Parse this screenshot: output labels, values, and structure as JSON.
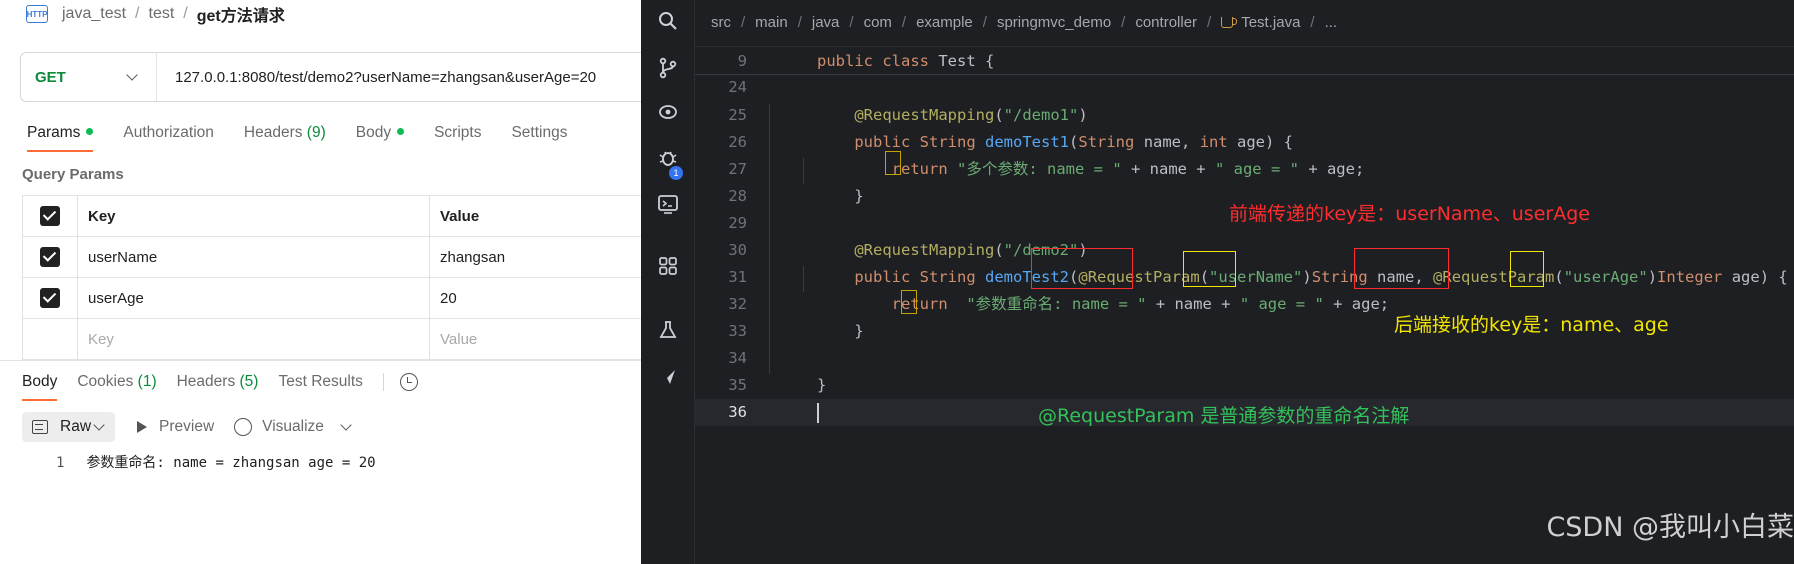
{
  "postman": {
    "breadcrumb": [
      "java_test",
      "test",
      "get方法请求"
    ],
    "http_icon_text": "HTTP",
    "method": "GET",
    "url": "127.0.0.1:8080/test/demo2?userName=zhangsan&userAge=20",
    "request_tabs": [
      {
        "label": "Params",
        "dot": true,
        "count": ""
      },
      {
        "label": "Authorization",
        "dot": false,
        "count": ""
      },
      {
        "label": "Headers",
        "dot": false,
        "count": "(9)"
      },
      {
        "label": "Body",
        "dot": true,
        "count": ""
      },
      {
        "label": "Scripts",
        "dot": false,
        "count": ""
      },
      {
        "label": "Settings",
        "dot": false,
        "count": ""
      }
    ],
    "query_params_title": "Query Params",
    "table_headers": {
      "key": "Key",
      "value": "Value"
    },
    "params": [
      {
        "key": "userName",
        "value": "zhangsan",
        "checked": true
      },
      {
        "key": "userAge",
        "value": "20",
        "checked": true
      }
    ],
    "placeholder_row": {
      "key": "Key",
      "value": "Value"
    },
    "response_tabs": [
      {
        "label": "Body",
        "count": ""
      },
      {
        "label": "Cookies",
        "count": "(1)"
      },
      {
        "label": "Headers",
        "count": "(5)"
      },
      {
        "label": "Test Results",
        "count": ""
      }
    ],
    "view": {
      "raw": "Raw",
      "preview": "Preview",
      "visualize": "Visualize"
    },
    "response_lines": [
      {
        "num": "1",
        "text": "参数重命名: name = zhangsan age = 20"
      }
    ]
  },
  "ide": {
    "breadcrumb": [
      "src",
      "main",
      "java",
      "com",
      "example",
      "springmvc_demo",
      "controller",
      "Test.java",
      "..."
    ],
    "debug_badge": "1",
    "icons": [
      "search-icon",
      "source-control-icon",
      "run-debug-icon",
      "bug-icon",
      "terminal-icon",
      "extensions-icon",
      "flask-icon",
      "navigate-icon"
    ],
    "lines": [
      {
        "num": "9",
        "text": "public class Test {"
      },
      {
        "num": "24",
        "text": ""
      },
      {
        "num": "25",
        "text": "    @RequestMapping(\"/demo1\")"
      },
      {
        "num": "26",
        "text": "    public String demoTest1(String name, int age) {"
      },
      {
        "num": "27",
        "text": "        return \"多个参数: name = \" + name + \" age = \" + age;"
      },
      {
        "num": "28",
        "text": "    }"
      },
      {
        "num": "29",
        "text": ""
      },
      {
        "num": "30",
        "text": "    @RequestMapping(\"/demo2\")"
      },
      {
        "num": "31",
        "text": "    public String demoTest2(@RequestParam(\"userName\")String name, @RequestParam(\"userAge\")Integer age) {"
      },
      {
        "num": "32",
        "text": "        return  \"参数重命名: name = \" + name + \" age = \" + age;"
      },
      {
        "num": "33",
        "text": "    }"
      },
      {
        "num": "34",
        "text": ""
      },
      {
        "num": "35",
        "text": "}"
      },
      {
        "num": "36",
        "text": ""
      }
    ],
    "notes": {
      "frontend": "前端传递的key是：userName、userAge",
      "backend": "后端接收的key是：name、age",
      "annotation": "@RequestParam 是普通参数的重命名注解"
    },
    "colors": {
      "red": "#ff2d2d",
      "yellow": "#f2e600",
      "green": "#33c25a"
    }
  },
  "watermark": "CSDN @我叫小白菜"
}
